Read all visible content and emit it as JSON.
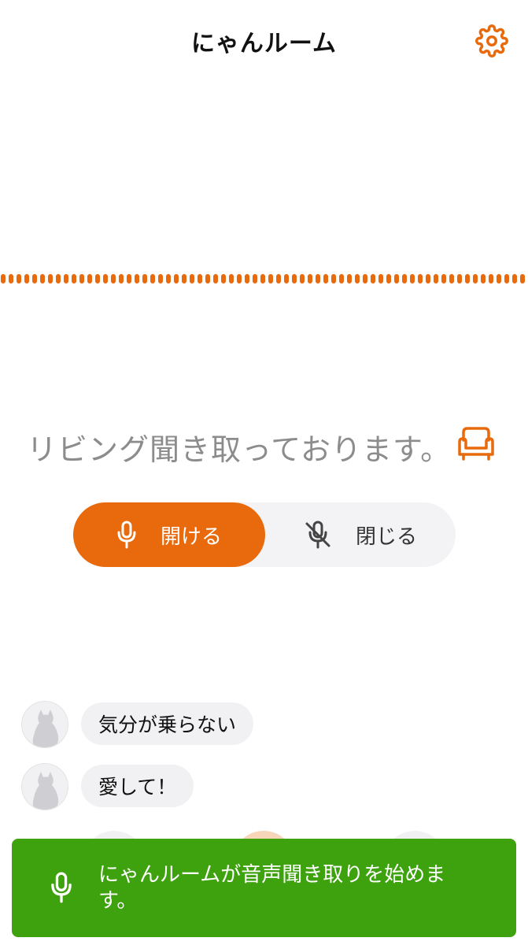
{
  "header": {
    "title": "にゃんルーム",
    "settings_icon": "gear-icon"
  },
  "colors": {
    "accent": "#e86a0c",
    "toast_bg": "#3da20e",
    "segment_bg": "#f3f3f5",
    "status_text": "#8c8c8c"
  },
  "status": {
    "text": "リビング聞き取っております。",
    "room_icon": "sofa-icon"
  },
  "segment": {
    "open_label": "開ける",
    "open_icon": "microphone-icon",
    "close_label": "閉じる",
    "close_icon": "microphone-off-icon",
    "selected": "open"
  },
  "messages": [
    {
      "avatar": "cat-silhouette-icon",
      "text": "気分が乗らない"
    },
    {
      "avatar": "cat-silhouette-icon",
      "text": "愛して！"
    }
  ],
  "toast": {
    "icon": "microphone-icon",
    "text": "にゃんルームが音声聞き取りを始めます。"
  }
}
